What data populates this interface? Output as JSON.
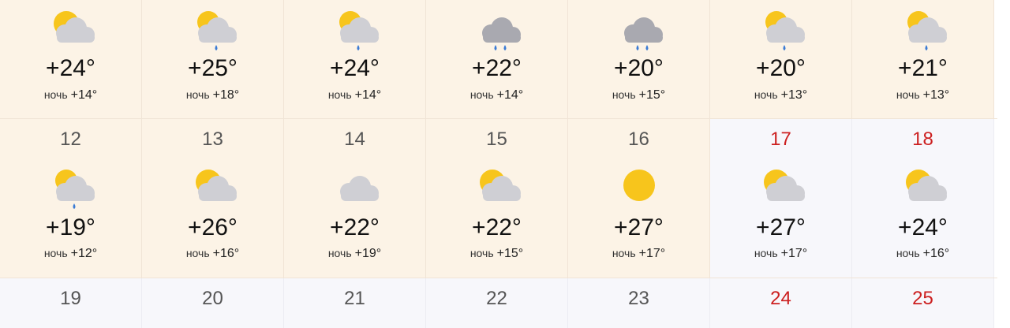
{
  "week1": [
    {
      "icon": "sun-cloud-icon",
      "temp": "+24°",
      "night_label": "ночь",
      "night_temp": "+14°"
    },
    {
      "icon": "sun-cloud-rain-icon",
      "temp": "+25°",
      "night_label": "ночь",
      "night_temp": "+18°"
    },
    {
      "icon": "sun-cloud-rain-icon",
      "temp": "+24°",
      "night_label": "ночь",
      "night_temp": "+14°"
    },
    {
      "icon": "dark-cloud-rain-icon",
      "temp": "+22°",
      "night_label": "ночь",
      "night_temp": "+14°"
    },
    {
      "icon": "dark-cloud-rain-icon",
      "temp": "+20°",
      "night_label": "ночь",
      "night_temp": "+15°"
    },
    {
      "icon": "sun-cloud-rain-icon",
      "temp": "+20°",
      "night_label": "ночь",
      "night_temp": "+13°"
    },
    {
      "icon": "sun-cloud-rain-icon",
      "temp": "+21°",
      "night_label": "ночь",
      "night_temp": "+13°"
    }
  ],
  "week2": [
    {
      "day": "12",
      "weekend": false,
      "icon": "sun-cloud-rain-icon",
      "temp": "+19°",
      "night_label": "ночь",
      "night_temp": "+12°"
    },
    {
      "day": "13",
      "weekend": false,
      "icon": "sun-cloud-icon",
      "temp": "+26°",
      "night_label": "ночь",
      "night_temp": "+16°"
    },
    {
      "day": "14",
      "weekend": false,
      "icon": "cloud-icon",
      "temp": "+22°",
      "night_label": "ночь",
      "night_temp": "+19°"
    },
    {
      "day": "15",
      "weekend": false,
      "icon": "sun-cloud-icon",
      "temp": "+22°",
      "night_label": "ночь",
      "night_temp": "+15°"
    },
    {
      "day": "16",
      "weekend": false,
      "icon": "sun-icon",
      "temp": "+27°",
      "night_label": "ночь",
      "night_temp": "+17°"
    },
    {
      "day": "17",
      "weekend": true,
      "icon": "sun-cloud-icon",
      "temp": "+27°",
      "night_label": "ночь",
      "night_temp": "+17°"
    },
    {
      "day": "18",
      "weekend": true,
      "icon": "sun-cloud-icon",
      "temp": "+24°",
      "night_label": "ночь",
      "night_temp": "+16°"
    }
  ],
  "week3": [
    {
      "day": "19",
      "weekend": false
    },
    {
      "day": "20",
      "weekend": false
    },
    {
      "day": "21",
      "weekend": false
    },
    {
      "day": "22",
      "weekend": false
    },
    {
      "day": "23",
      "weekend": false
    },
    {
      "day": "24",
      "weekend": true
    },
    {
      "day": "25",
      "weekend": true
    }
  ],
  "colors": {
    "weekend": "#cc1f1f",
    "sun": "#f7c51c",
    "cloud": "#cfcfd4",
    "dark_cloud": "#a9a9b0",
    "rain": "#3b7bd4"
  }
}
